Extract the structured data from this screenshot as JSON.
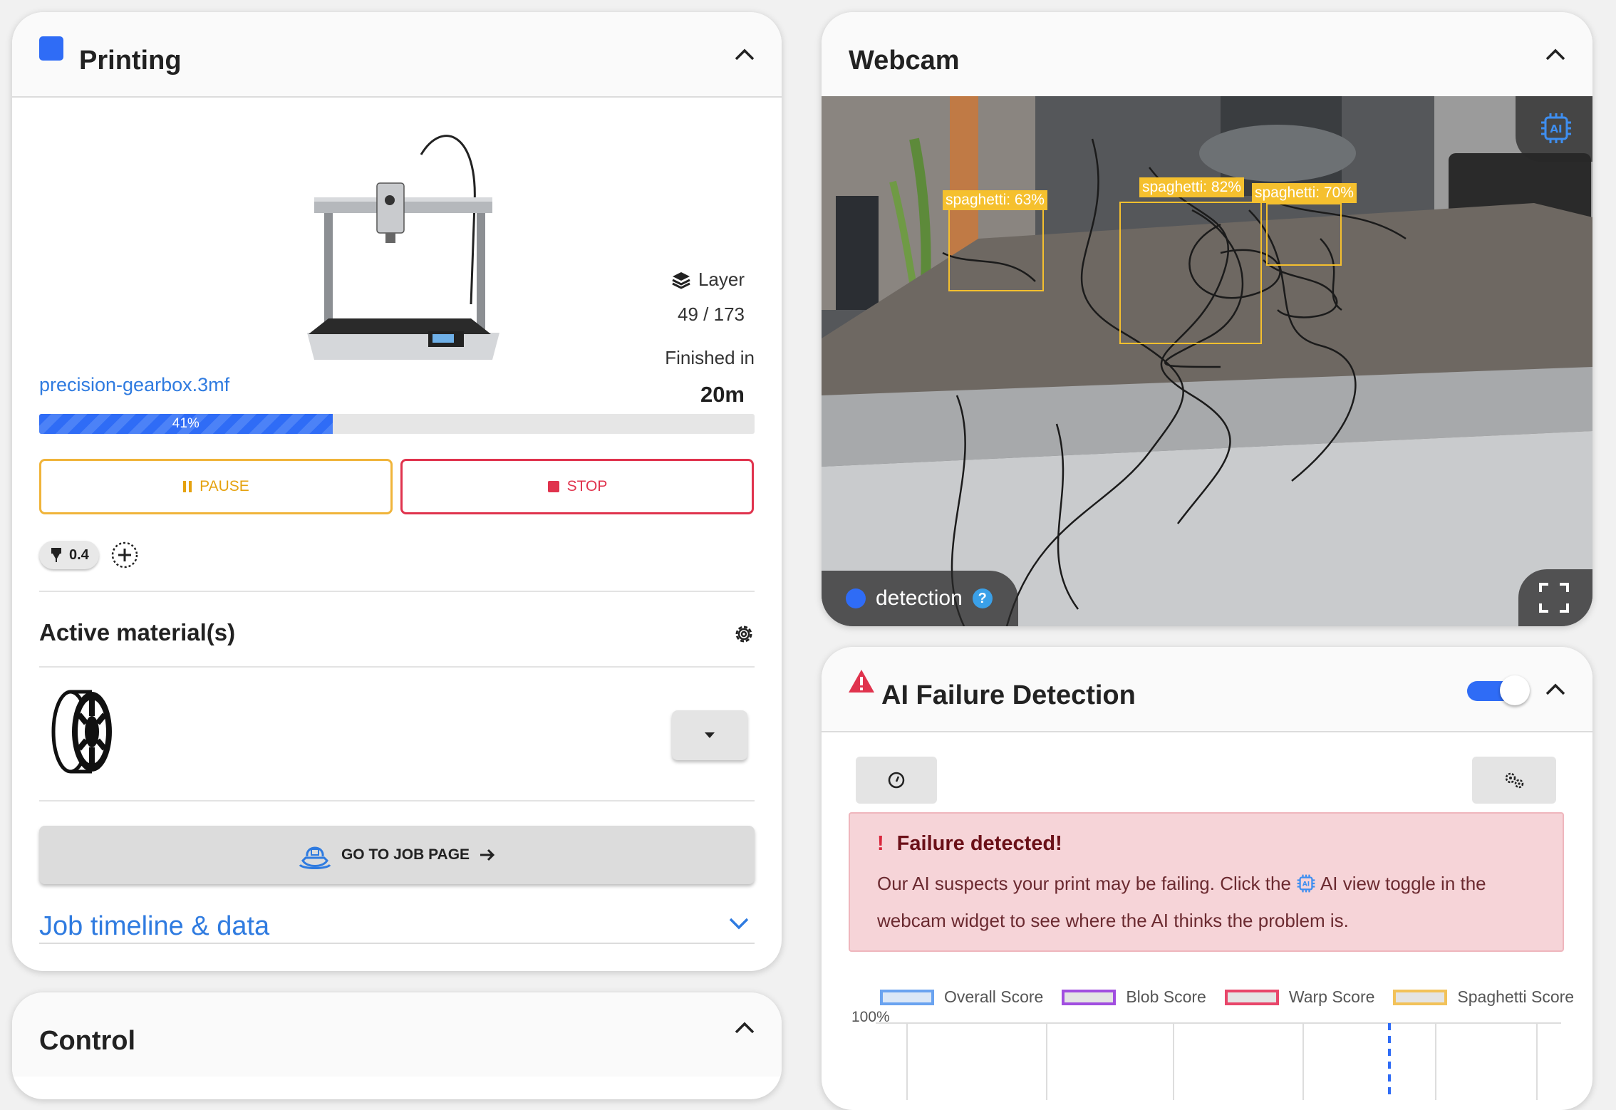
{
  "printing": {
    "title": "Printing",
    "layer_label": "Layer",
    "layer_value": "49 / 173",
    "finished_label": "Finished in",
    "finished_value": "20m",
    "filename": "precision-gearbox.3mf",
    "progress": 0.41,
    "progress_label": "41%",
    "pause_label": "PAUSE",
    "stop_label": "STOP",
    "nozzle": "0.4",
    "materials_title": "Active material(s)",
    "job_button": "GO TO JOB PAGE",
    "timeline_label": "Job timeline & data",
    "colors": {
      "accent": "#2f6cf6",
      "pause": "#f0b43a",
      "stop": "#e0334d",
      "link": "#2f7be0"
    }
  },
  "control": {
    "title": "Control"
  },
  "webcam": {
    "title": "Webcam",
    "detection_label": "detection",
    "boxes": [
      {
        "label": "spaghetti: 63%"
      },
      {
        "label": "spaghetti: 82%"
      },
      {
        "label": "spaghetti: 70%"
      }
    ]
  },
  "ai": {
    "title": "AI Failure Detection",
    "alert_title": "Failure detected!",
    "alert_body_1": "Our AI suspects your print may be failing. Click the",
    "alert_body_2": "AI view toggle in the webcam widget to see where the AI thinks the problem is.",
    "legend": [
      {
        "name": "Overall Score",
        "color": "#6aa3f0"
      },
      {
        "name": "Blob Score",
        "color": "#a14ee0"
      },
      {
        "name": "Warp Score",
        "color": "#e8466a"
      },
      {
        "name": "Spaghetti Score",
        "color": "#f2c25a"
      }
    ],
    "y_label_top": "100%",
    "toggle_on": true
  }
}
